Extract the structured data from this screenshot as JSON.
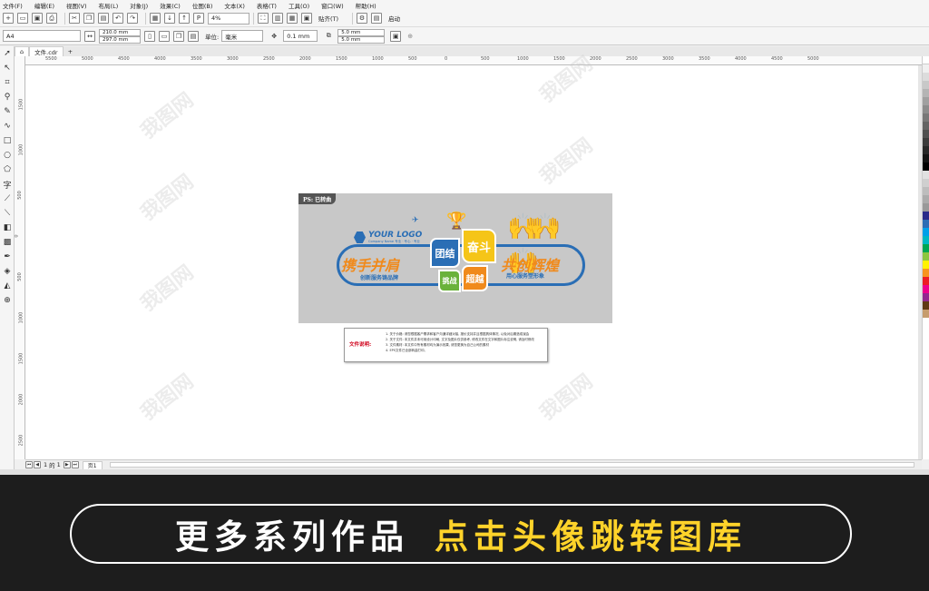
{
  "menu": [
    "文件(F)",
    "编辑(E)",
    "视图(V)",
    "布局(L)",
    "对象(J)",
    "效果(C)",
    "位图(B)",
    "文本(X)",
    "表格(T)",
    "工具(O)",
    "窗口(W)",
    "帮助(H)"
  ],
  "toolbar": {
    "zoom": "4%",
    "snap": "贴齐(T)",
    "launch": "启动"
  },
  "propbar": {
    "page_size": "A4",
    "width": "210.0 mm",
    "height": "297.0 mm",
    "unit_label": "单位:",
    "unit": "毫米",
    "nudge": "0.1 mm",
    "dup_x": "5.0 mm",
    "dup_y": "5.0 mm"
  },
  "tab": {
    "filename": "文件.cdr"
  },
  "ruler": [
    "5500",
    "5000",
    "4500",
    "4000",
    "3500",
    "3000",
    "2500",
    "2000",
    "1500",
    "1000",
    "500",
    "0",
    "500",
    "1000",
    "1500",
    "2000",
    "2500",
    "3000",
    "3500",
    "4000",
    "4500",
    "5000"
  ],
  "vruler": [
    "1500",
    "1000",
    "500",
    "0",
    "500",
    "1000",
    "1500",
    "2000",
    "2500"
  ],
  "pager": {
    "current": "1",
    "of": "的",
    "total": "1",
    "page_tab": "页1"
  },
  "design": {
    "ps": "PS: 已转曲",
    "logo": "YOUR LOGO",
    "logo_sub": "Company Name 专业 · 专心 · 专业",
    "left_slogan": "携手并肩",
    "left_sub": "创新服务铸品牌",
    "right_slogan": "共创辉煌",
    "right_sub": "用心服务塑形象",
    "b1": "团结",
    "b2": "奋斗",
    "b3": "挑战",
    "b4": "超越"
  },
  "notes": {
    "title": "文件说明:",
    "lines": [
      "1. 关于价格: 请您根据客户需求和客户沟通详细对接, 报价支持并且根据具体情况, 以免对后期造成误会",
      "2. 关于文件: 本文件并未可用设计印刷, 文字及图片仅供参考, 修改文件在文字和图片标注说明, 请及时修改",
      "3. 文件素材: 本文件中所有素材均为演示效果, 请您更换为自己公司的素材",
      "4. EPS文件已全部转曲打印。"
    ]
  },
  "watermark": "我图网",
  "banner": {
    "white": "更多系列作品",
    "yellow": "点击头像跳转图库"
  },
  "colors": {
    "accent_blue": "#2a6eb5",
    "orange": "#f08a1c",
    "yellow": "#f5c518",
    "green": "#6ab23b",
    "banner_yellow": "#ffd32a"
  }
}
